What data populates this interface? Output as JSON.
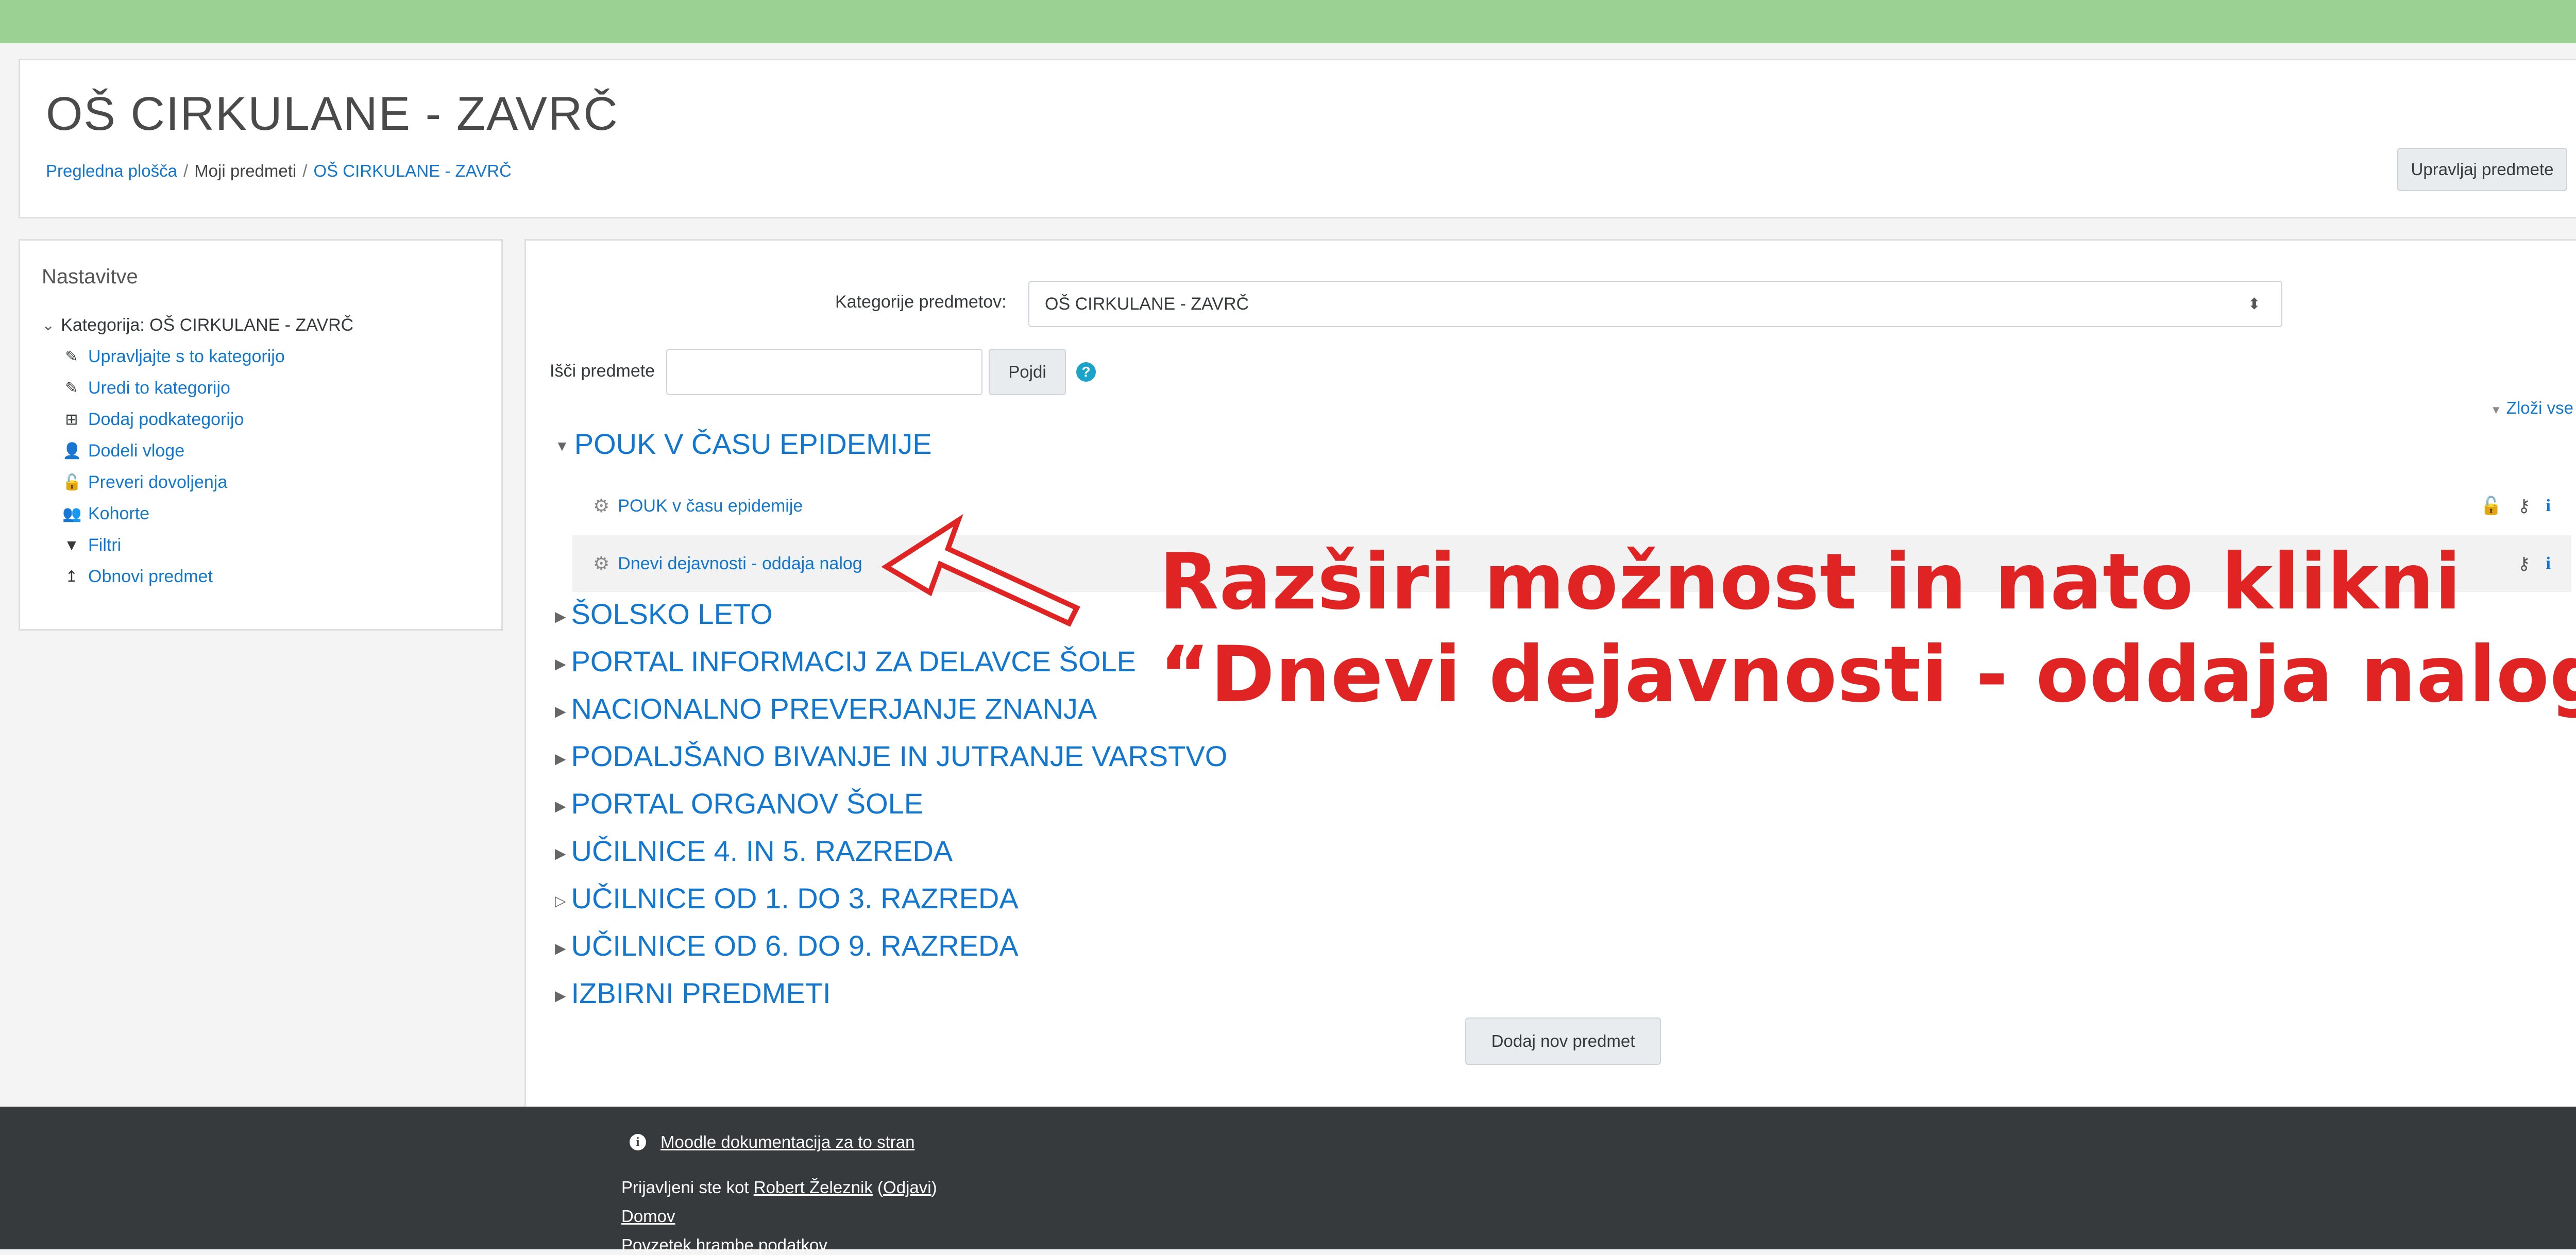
{
  "header": {
    "title": "OŠ CIRKULANE - ZAVRČ",
    "breadcrumb": [
      "Pregledna plošča",
      "Moji predmeti",
      "OŠ CIRKULANE - ZAVRČ"
    ],
    "manage_button": "Upravljaj predmete"
  },
  "settings_block": {
    "title": "Nastavitve",
    "category": "Kategorija: OŠ CIRKULANE - ZAVRČ",
    "items": [
      {
        "label": "Upravljajte s to kategorijo",
        "icon": "pencil-icon"
      },
      {
        "label": "Uredi to kategorijo",
        "icon": "pencil-icon"
      },
      {
        "label": "Dodaj podkategorijo",
        "icon": "plus-square-icon"
      },
      {
        "label": "Dodeli vloge",
        "icon": "user-plus-icon"
      },
      {
        "label": "Preveri dovoljenja",
        "icon": "unlock-icon"
      },
      {
        "label": "Kohorte",
        "icon": "users-icon"
      },
      {
        "label": "Filtri",
        "icon": "filter-icon"
      },
      {
        "label": "Obnovi predmet",
        "icon": "restore-icon"
      }
    ]
  },
  "main": {
    "category_select_label": "Kategorije predmetov:",
    "category_select_value": "OŠ CIRKULANE - ZAVRČ",
    "search_label": "Išči predmete",
    "search_button": "Pojdi",
    "collapse_all": "Zloži vse",
    "expanded_category": "POUK V ČASU EPIDEMIJE",
    "courses": [
      {
        "name": "POUK v času epidemije",
        "icons": [
          "unlock-icon",
          "key-icon",
          "info-icon"
        ]
      },
      {
        "name": "Dnevi dejavnosti - oddaja nalog",
        "icons": [
          "key-icon",
          "info-icon"
        ]
      }
    ],
    "categories": [
      "ŠOLSKO LETO",
      "PORTAL INFORMACIJ ZA DELAVCE ŠOLE",
      "NACIONALNO PREVERJANJE ZNANJA",
      "PODALJŠANO BIVANJE IN JUTRANJE VARSTVO",
      "PORTAL ORGANOV ŠOLE",
      "UČILNICE 4. IN 5. RAZREDA",
      "UČILNICE OD 1. DO 3. RAZREDA",
      "UČILNICE OD 6. DO 9. RAZREDA",
      "IZBIRNI PREDMETI"
    ],
    "add_course_button": "Dodaj nov predmet"
  },
  "annotation": {
    "line1": "Razširi možnost in nato klikni",
    "line2": "“Dnevi dejavnosti - oddaja nalog”",
    "color": "#e02424"
  },
  "footer": {
    "docs_link": "Moodle dokumentacija za to stran",
    "logged_in_prefix": "Prijavljeni ste kot ",
    "user_name": "Robert Železnik",
    "logout": "Odjavi",
    "home": "Domov",
    "privacy": "Povzetek hrambe podatkov"
  },
  "colors": {
    "topbar": "#9bd193",
    "link": "#1177d1",
    "footer_bg": "#373a3c"
  }
}
